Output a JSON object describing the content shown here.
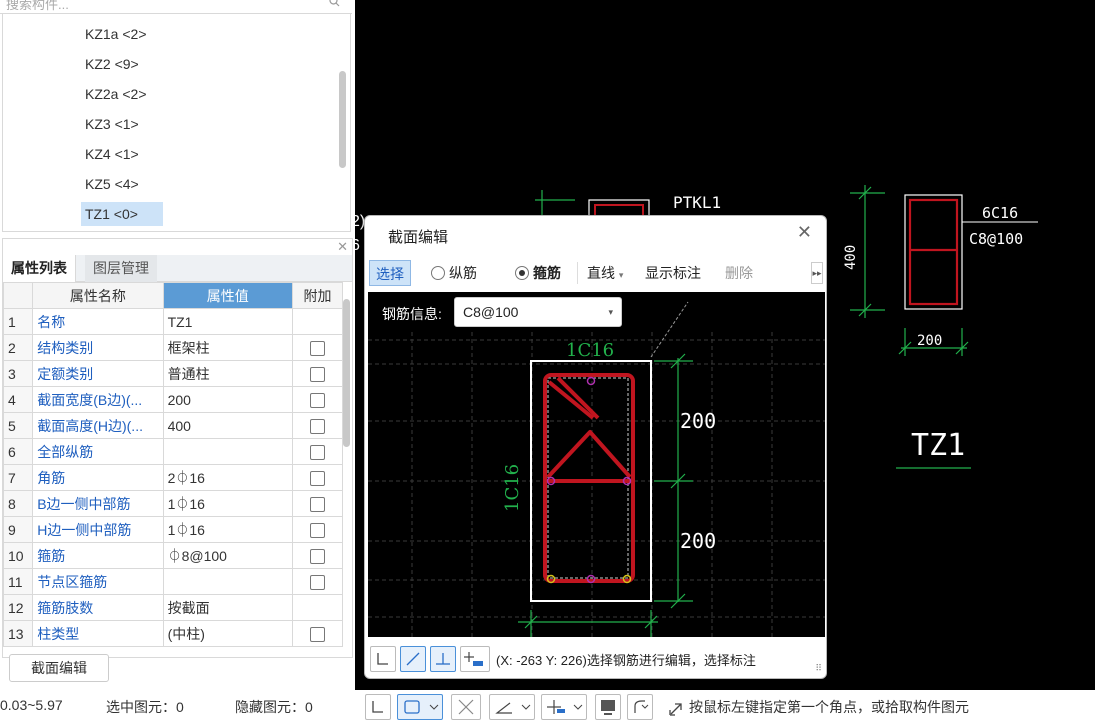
{
  "search": {
    "placeholder": "搜索构件..."
  },
  "components": [
    {
      "label": "KZ1a <2>"
    },
    {
      "label": "KZ2 <9>"
    },
    {
      "label": "KZ2a <2>"
    },
    {
      "label": "KZ3 <1>"
    },
    {
      "label": "KZ4 <1>"
    },
    {
      "label": "KZ5 <4>"
    },
    {
      "label": "TZ1 <0>",
      "selected": true
    }
  ],
  "tabs": {
    "properties": "属性列表",
    "layers": "图层管理"
  },
  "table": {
    "col_name": "属性名称",
    "col_value": "属性值",
    "col_add": "附加",
    "rows": [
      {
        "num": "1",
        "name": "名称",
        "value": "TZ1",
        "checkbox": false
      },
      {
        "num": "2",
        "name": "结构类别",
        "value": "框架柱",
        "checkbox": true
      },
      {
        "num": "3",
        "name": "定额类别",
        "value": "普通柱",
        "checkbox": true
      },
      {
        "num": "4",
        "name": "截面宽度(B边)(...",
        "value": "200",
        "checkbox": true
      },
      {
        "num": "5",
        "name": "截面高度(H边)(...",
        "value": "400",
        "checkbox": true
      },
      {
        "num": "6",
        "name": "全部纵筋",
        "value": "",
        "checkbox": true
      },
      {
        "num": "7",
        "name": "角筋",
        "value": "2⏀16",
        "checkbox": true
      },
      {
        "num": "8",
        "name": "B边一侧中部筋",
        "value": "1⏀16",
        "checkbox": true
      },
      {
        "num": "9",
        "name": "H边一侧中部筋",
        "value": "1⏀16",
        "checkbox": true
      },
      {
        "num": "10",
        "name": "箍筋",
        "value": "⏀8@100",
        "checkbox": true
      },
      {
        "num": "11",
        "name": "节点区箍筋",
        "value": "",
        "checkbox": true
      },
      {
        "num": "12",
        "name": "箍筋肢数",
        "value": "按截面",
        "checkbox": false
      },
      {
        "num": "13",
        "name": "柱类型",
        "value": "(中柱)",
        "checkbox": true
      }
    ]
  },
  "section_edit_button": "截面编辑",
  "status": {
    "range": "0.03~5.97",
    "selected": "选中图元：0",
    "hidden": "隐藏图元：0"
  },
  "drawing": {
    "ptkl": "PTKL1",
    "dim_400": "400",
    "dim_200": "200",
    "label_6c16": "6C16",
    "label_c8": "C8@100",
    "label_tz1": "TZ1"
  },
  "dialog": {
    "title": "截面编辑",
    "select": "选择",
    "longitudinal": "纵筋",
    "stirrup": "箍筋",
    "line_mode": "直线",
    "show_label": "显示标注",
    "delete": "删除",
    "rebar_info_label": "钢筋信息:",
    "rebar_info_value": "C8@100",
    "top_label": "1C16",
    "side_label": "1C16",
    "dim_upper": "200",
    "dim_lower": "200",
    "status": "(X: -263 Y: 226)选择钢筋进行编辑，选择标注"
  },
  "bottom_hint": "按鼠标左键指定第一个角点，或拾取构件图元",
  "colors": {
    "rebar": "#c0151f",
    "dim": "#22b14c",
    "accent": "#5b9bd5"
  }
}
